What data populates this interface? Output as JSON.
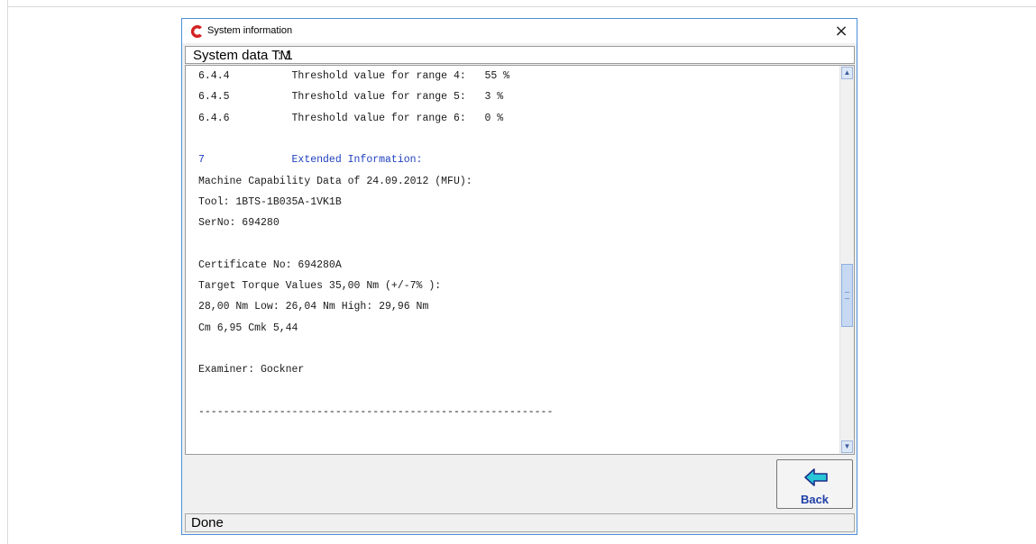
{
  "window": {
    "title": "System information",
    "close_glyph": "×",
    "logo_icon": "app-c-logo-icon",
    "logo_color": "#d42020"
  },
  "header": {
    "label": "System data TM",
    "value": ": 1"
  },
  "content": {
    "lines": [
      {
        "text": "6.4.4          Threshold value for range 4:   55 %",
        "style": "normal"
      },
      {
        "text": "6.4.5          Threshold value for range 5:   3 %",
        "style": "normal"
      },
      {
        "text": "6.4.6          Threshold value for range 6:   0 %",
        "style": "normal"
      },
      {
        "text": "",
        "style": "normal"
      },
      {
        "text": "7              Extended Information:",
        "style": "blue"
      },
      {
        "text": "Machine Capability Data of 24.09.2012 (MFU):",
        "style": "normal"
      },
      {
        "text": "Tool: 1BTS-1B035A-1VK1B",
        "style": "normal"
      },
      {
        "text": "SerNo: 694280",
        "style": "normal"
      },
      {
        "text": "",
        "style": "normal"
      },
      {
        "text": "Certificate No: 694280A",
        "style": "normal"
      },
      {
        "text": "Target Torque Values 35,00 Nm (+/-7% ):",
        "style": "normal"
      },
      {
        "text": "28,00 Nm Low: 26,04 Nm High: 29,96 Nm",
        "style": "normal"
      },
      {
        "text": "Cm 6,95 Cmk 5,44",
        "style": "normal"
      },
      {
        "text": "",
        "style": "normal"
      },
      {
        "text": "Examiner: Gockner",
        "style": "normal"
      },
      {
        "text": "",
        "style": "normal"
      },
      {
        "text": "---------------------------------------------------------",
        "style": "normal"
      }
    ],
    "scroll_position": 0.62
  },
  "buttons": {
    "back_label": "Back",
    "back_icon": "arrow-left-icon",
    "back_icon_color": "#28c6d6"
  },
  "status": {
    "text": "Done"
  },
  "scrollbar": {
    "up_glyph": "▲",
    "down_glyph": "▼"
  }
}
